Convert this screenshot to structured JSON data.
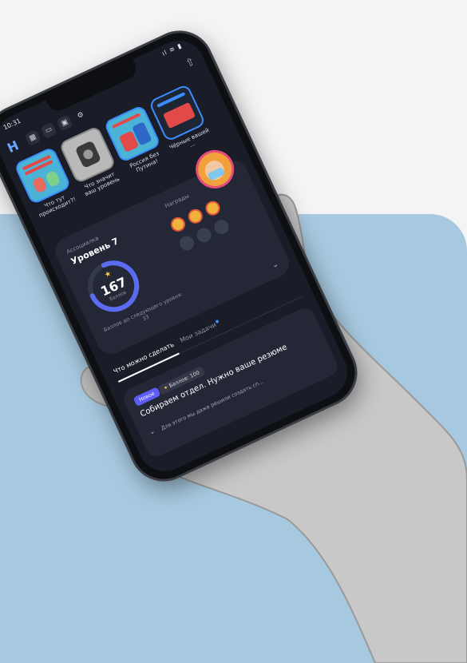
{
  "status_bar": {
    "time": "10:31",
    "icons": "ıl ≋ ▮"
  },
  "app": {
    "logo": "H",
    "toolbar": [
      "▦",
      "▭",
      "▣"
    ],
    "settings_glyph": "⚙",
    "right_glyph": "⇧"
  },
  "stories": [
    {
      "label": "Что тут происходит?!"
    },
    {
      "label": "Что значит ваш уровень"
    },
    {
      "label": "Россия без Путина!"
    },
    {
      "label": "Чёрные вашей ..."
    }
  ],
  "level": {
    "caption": "Ассоциалка",
    "title": "Уровень 7",
    "points": "167",
    "points_unit": "баллов",
    "next_level_text": "Баллов до следующего уровня: 33",
    "progress": 0.75,
    "awards_title": "Награды"
  },
  "tabs": {
    "active": "Что можно сделать",
    "inactive": "Мои задачи"
  },
  "task": {
    "badge_new": "Новое",
    "badge_points": "Баллов: 100",
    "title": "Собираем отдел. Нужно ваше резюме",
    "description": "Для этого мы даже решили создать сп..."
  },
  "colors": {
    "accent": "#3a8cff",
    "panel": "#a7c9e0",
    "screen": "#1a1d27"
  }
}
